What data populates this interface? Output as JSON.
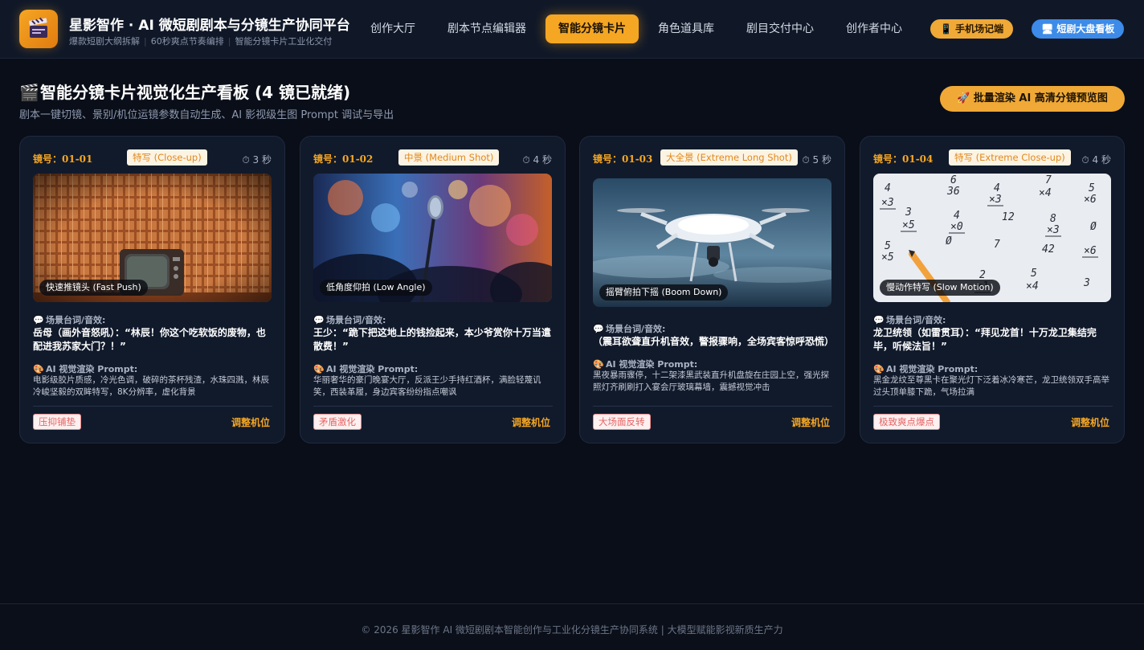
{
  "header": {
    "brand_title": "星影智作 · AI 微短剧剧本与分镜生产协同平台",
    "brand_sub": [
      "爆款短剧大纲拆解",
      "60秒爽点节奏编排",
      "智能分镜卡片工业化交付"
    ],
    "nav": [
      "创作大厅",
      "剧本节点编辑器",
      "智能分镜卡片",
      "角色道具库",
      "剧目交付中心",
      "创作者中心"
    ],
    "active_nav": "智能分镜卡片",
    "mobile_pill": "手机场记端",
    "board_pill": "短剧大盘看板"
  },
  "page": {
    "title": "智能分镜卡片视觉化生产看板 (4 镜已就绪)",
    "desc": "剧本一键切镜、景别/机位运镜参数自动生成、AI 影视级生图 Prompt 调试与导出",
    "batch_button": "批量渲染 AI 高清分镜预览图"
  },
  "labels": {
    "dialog_label": "场景台词/音效:",
    "prompt_label": "AI 视觉渲染 Prompt:",
    "adjust": "调整机位"
  },
  "cards": [
    {
      "no": "镜号：01-01",
      "shot": "特写 (Close-up)",
      "duration": "3 秒",
      "camera": "快速推镜头 (Fast Push)",
      "dialog": "岳母（画外音怒吼）：“林辰！你这个吃软饭的废物，也配进我苏家大门？！”",
      "prompt": "电影级胶片质感，冷光色调，破碎的茶杯残渣，水珠四溅，林辰冷峻坚毅的双眸特写，8K分辨率，虚化背景",
      "mood": "压抑铺垫",
      "image": "retro-tv-icon"
    },
    {
      "no": "镜号：01-02",
      "shot": "中景 (Medium Shot)",
      "duration": "4 秒",
      "camera": "低角度仰拍 (Low Angle)",
      "dialog": "王少：“跪下把这地上的钱捡起来，本少爷赏你十万当遣散费！”",
      "prompt": "华丽奢华的豪门晚宴大厅，反派王少手持红酒杯，满脸轻蔑讥笑，西装革履，身边宾客纷纷指点嘲讽",
      "mood": "矛盾激化",
      "image": "stage-microphone-icon"
    },
    {
      "no": "镜号：01-03",
      "shot": "大全景 (Extreme Long Shot)",
      "duration": "5 秒",
      "camera": "摇臂俯拍下摇 (Boom Down)",
      "dialog": "（震耳欲聋直升机音效，警报骤响，全场宾客惊呼恐慌）",
      "prompt": "黑夜暴雨骤停，十二架漆黑武装直升机盘旋在庄园上空，强光探照灯齐刷刷打入宴会厅玻璃幕墙，震撼视觉冲击",
      "mood": "大场面反转",
      "image": "drone-icon"
    },
    {
      "no": "镜号：01-04",
      "shot": "特写 (Extreme Close-up)",
      "duration": "4 秒",
      "camera": "慢动作特写 (Slow Motion)",
      "dialog": "龙卫统领（如雷贯耳）：“拜见龙首！十万龙卫集结完毕，听候法旨！”",
      "prompt": "黑金龙纹至尊黑卡在聚光灯下泛着冰冷寒芒，龙卫统领双手高举过头顶单膝下跪，气场拉满",
      "mood": "极致爽点爆点",
      "image": "math-worksheet-icon"
    }
  ],
  "footer": "© 2026 星影智作 AI 微短剧剧本智能创作与工业化分镜生产协同系统 | 大模型赋能影视新质生产力"
}
